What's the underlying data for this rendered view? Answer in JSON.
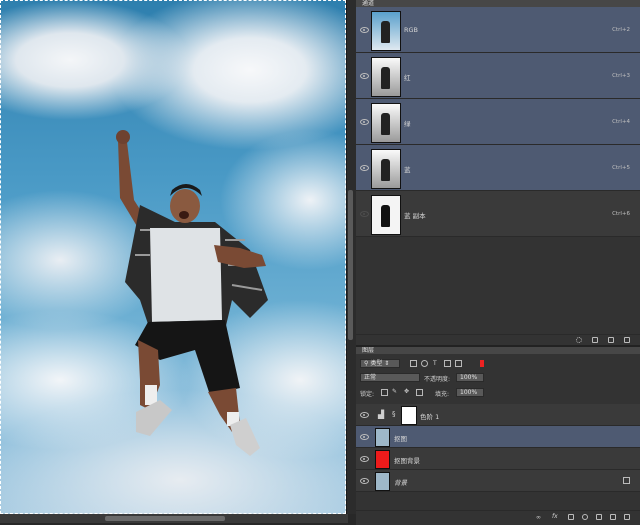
{
  "channels_panel": {
    "tab_label": "通道",
    "channels": [
      {
        "name": "RGB",
        "shortcut": "Ctrl+2",
        "selected": true,
        "thumb": "color"
      },
      {
        "name": "红",
        "shortcut": "Ctrl+3",
        "selected": true,
        "thumb": "gray"
      },
      {
        "name": "绿",
        "shortcut": "Ctrl+4",
        "selected": true,
        "thumb": "gray"
      },
      {
        "name": "蓝",
        "shortcut": "Ctrl+5",
        "selected": true,
        "thumb": "gray"
      },
      {
        "name": "蓝 副本",
        "shortcut": "Ctrl+6",
        "selected": false,
        "thumb": "mask"
      }
    ],
    "footer_icons": [
      "dotted-circle-icon",
      "mask-icon",
      "new-channel-icon",
      "trash-icon"
    ]
  },
  "layers_panel": {
    "tab_label": "图层",
    "filter_label": "类型",
    "blend_mode": "正常",
    "opacity_label": "不透明度:",
    "opacity_value": "100%",
    "lock_label": "锁定:",
    "fill_label": "填充:",
    "fill_value": "100%",
    "layers": [
      {
        "name": "色阶 1",
        "type": "adjustment",
        "selected": false
      },
      {
        "name": "抠图",
        "type": "image",
        "selected": true
      },
      {
        "name": "抠图背景",
        "type": "red-fill",
        "selected": false
      },
      {
        "name": "背景",
        "type": "image",
        "selected": false,
        "locked": true
      }
    ],
    "footer_icons": [
      "link-icon",
      "fx-icon",
      "mask-icon",
      "adjustment-icon",
      "folder-icon",
      "new-layer-icon",
      "trash-icon"
    ]
  },
  "colors": {
    "selected_row": "#4e5a72",
    "panel_bg": "#333333",
    "red_fill": "#ee1b1b"
  }
}
